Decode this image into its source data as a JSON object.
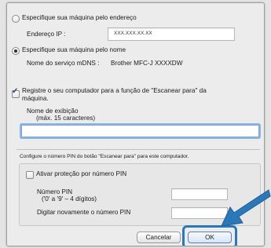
{
  "dialog": {
    "option_address": {
      "label": "Especifique sua máquina pelo endereço",
      "ip_label": "Endereço IP :",
      "ip_value": "XXX.XXX.XX.XX"
    },
    "option_name": {
      "label": "Especifique sua máquina pelo nome",
      "mdns_label": "Nome do serviço mDNS :",
      "mdns_value": "Brother MFC-J XXXXDW"
    },
    "register": {
      "label_line1": "Registre o seu computador para a função de \"Escanear para\" da",
      "label_line2": "máquina."
    },
    "display_name": {
      "label": "Nome de exibição",
      "hint": "(máx. 15 caracteres)",
      "value": ""
    },
    "pin_section": {
      "intro": "Configure o número PIN do botão \"Escanear para\" para este computador.",
      "enable_label": "Ativar proteção por número PIN",
      "pin_label": "Número PIN",
      "pin_hint": "('0' a '9' – 4 dígitos)",
      "pin_confirm_label": "Digitar novamente o número PIN",
      "pin_value": "",
      "pin_confirm_value": ""
    },
    "buttons": {
      "cancel": "Cancelar",
      "ok": "OK"
    }
  },
  "colors": {
    "callout_arrow": "#2b78b8",
    "focus_ring": "#8bb6e8"
  }
}
